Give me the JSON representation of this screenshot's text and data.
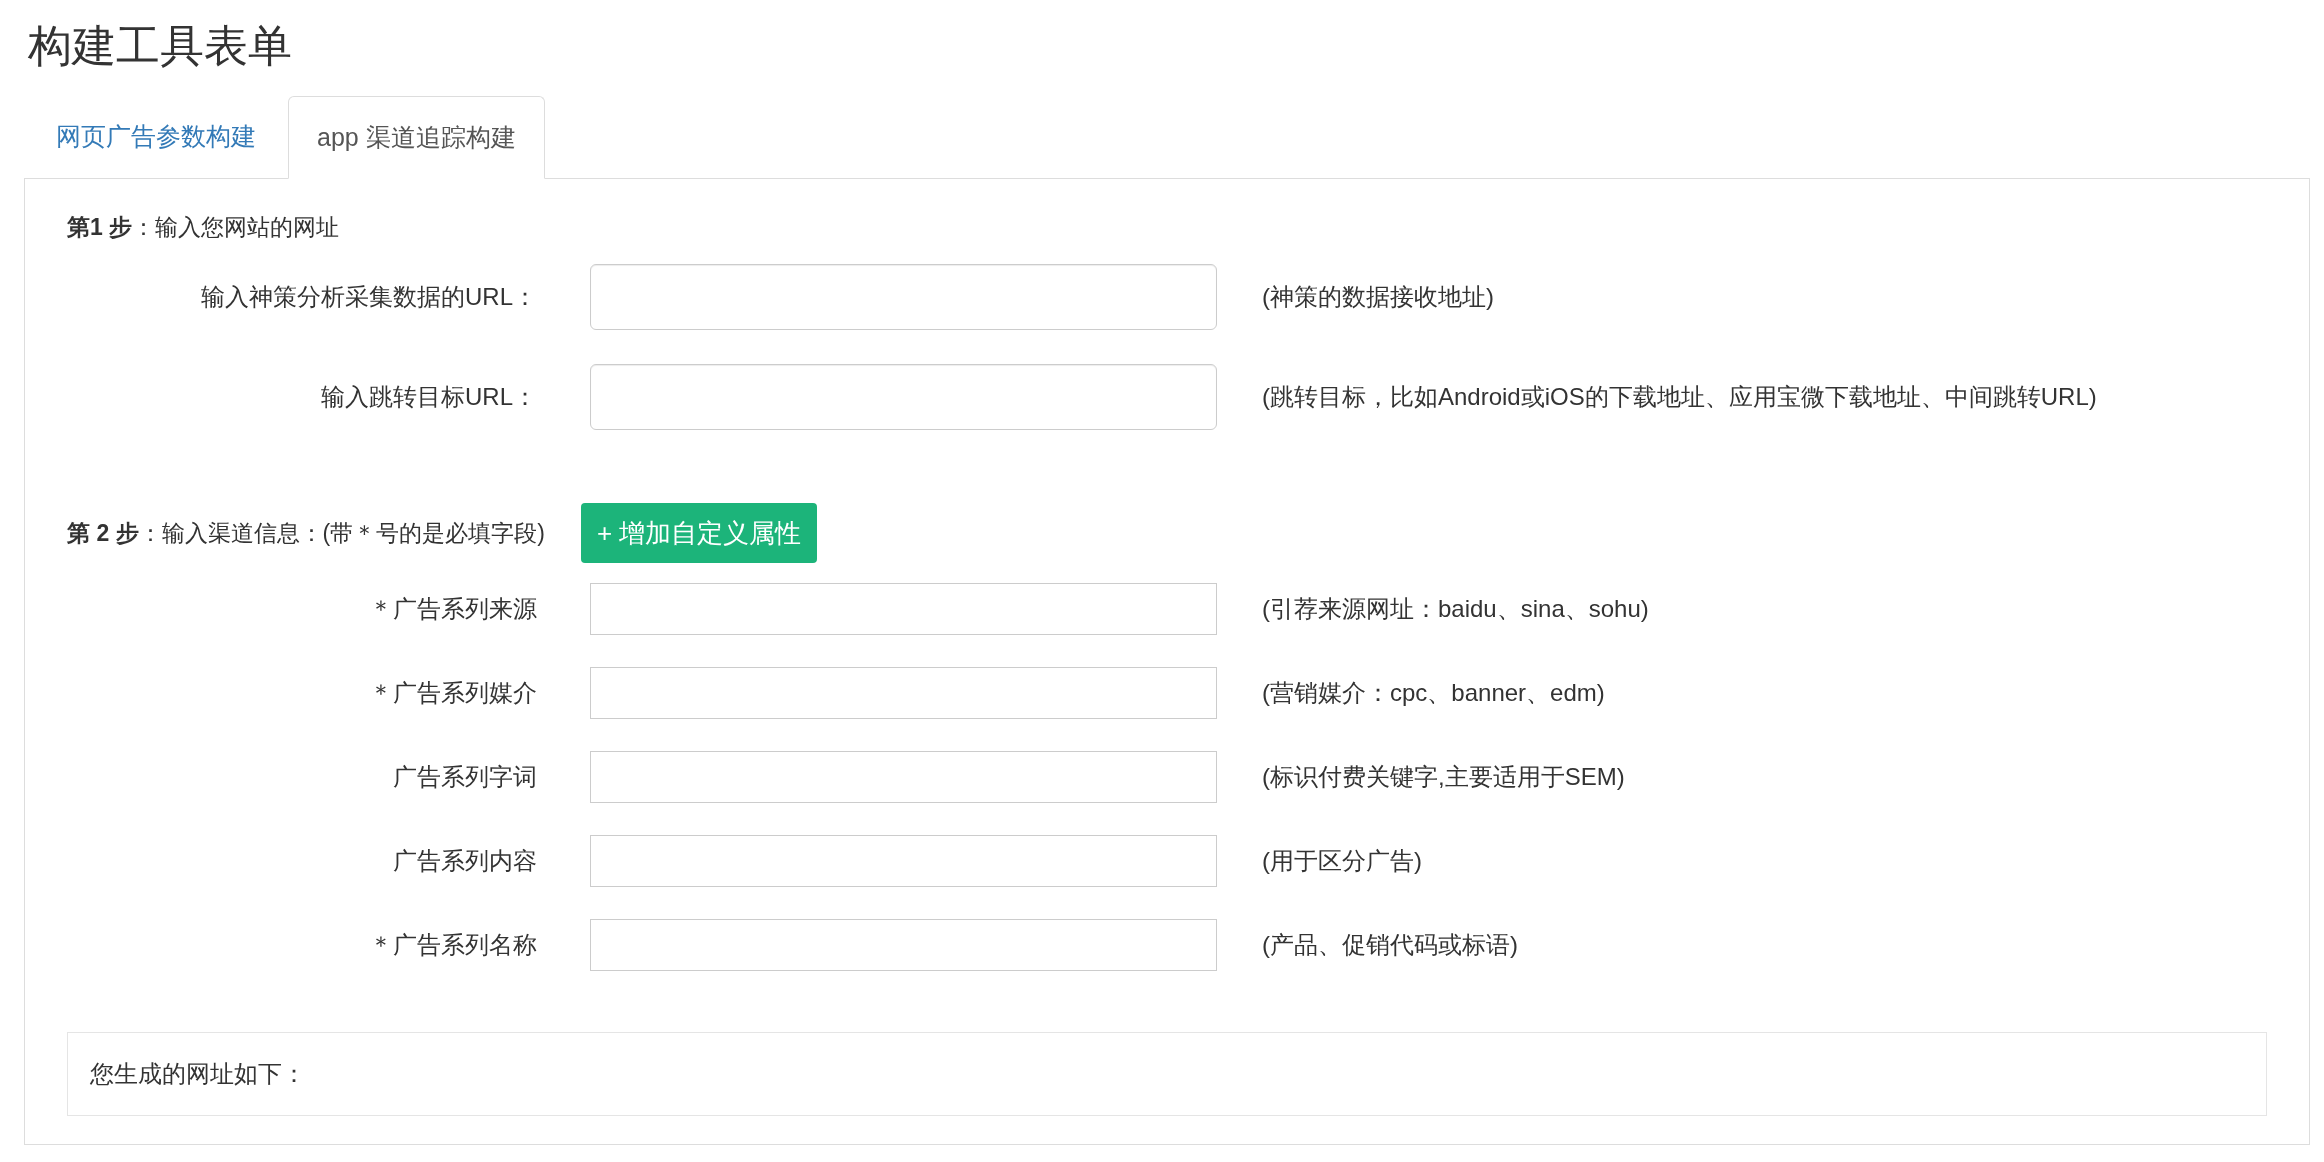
{
  "page_title": "构建工具表单",
  "tabs": [
    {
      "label": "网页广告参数构建",
      "selected": false
    },
    {
      "label": "app 渠道追踪构建",
      "selected": true
    }
  ],
  "step1": {
    "heading": "**第1 步**：输入您网站的网址",
    "fields": [
      {
        "label": "输入神策分析采集数据的URL：",
        "hint": "(神策的数据接收地址)"
      },
      {
        "label": "输入跳转目标URL：",
        "hint": "(跳转目标，比如Android或iOS的下载地址、应用宝微下载地址、中间跳转URL)"
      }
    ]
  },
  "step2": {
    "heading": "**第 2 步**：输入渠道信息：(带＊号的是必填字段)",
    "add_button": "+ 增加自定义属性",
    "fields": [
      {
        "label": "＊广告系列来源",
        "hint": "(引荐来源网址：baidu、sina、sohu)"
      },
      {
        "label": "＊广告系列媒介",
        "hint": "(营销媒介：cpc、banner、edm)"
      },
      {
        "label": "广告系列字词",
        "hint": "(标识付费关键字,主要适用于SEM)"
      },
      {
        "label": "广告系列内容",
        "hint": "(用于区分广告)"
      },
      {
        "label": "＊广告系列名称",
        "hint": "(产品、促销代码或标语)"
      }
    ]
  },
  "result": {
    "label": "您生成的网址如下："
  }
}
